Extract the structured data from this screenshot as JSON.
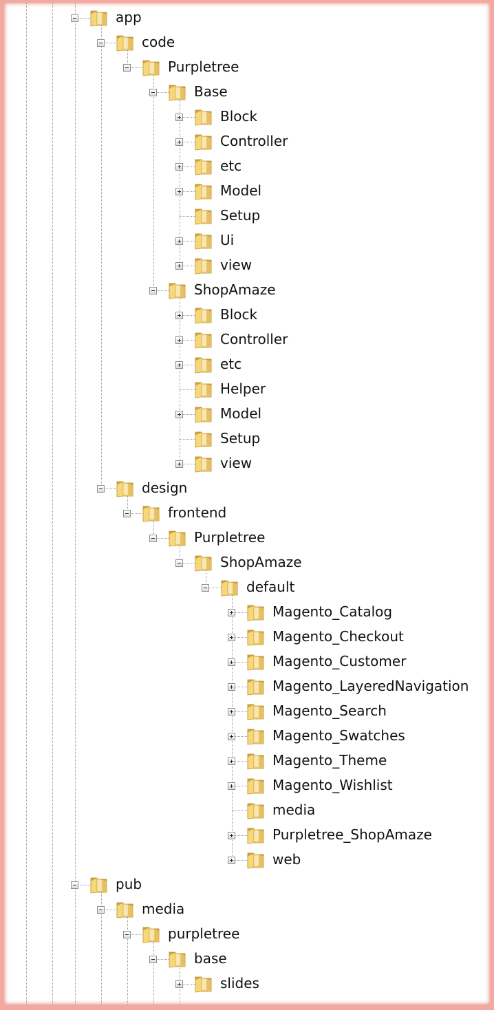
{
  "tree": {
    "expander_icons": {
      "expanded": "minus-box-icon",
      "collapsed": "plus-box-icon"
    },
    "folder_icon": "folder-icon",
    "colors": {
      "folder_back": "#d6a640",
      "folder_front": "#f6d77a",
      "connector": "#9a9a9a"
    },
    "nodes": [
      {
        "label": "app",
        "depth": 0,
        "state": "expanded"
      },
      {
        "label": "code",
        "depth": 1,
        "state": "expanded"
      },
      {
        "label": "Purpletree",
        "depth": 2,
        "state": "expanded"
      },
      {
        "label": "Base",
        "depth": 3,
        "state": "expanded"
      },
      {
        "label": "Block",
        "depth": 4,
        "state": "collapsed"
      },
      {
        "label": "Controller",
        "depth": 4,
        "state": "collapsed"
      },
      {
        "label": "etc",
        "depth": 4,
        "state": "collapsed"
      },
      {
        "label": "Model",
        "depth": 4,
        "state": "collapsed"
      },
      {
        "label": "Setup",
        "depth": 4,
        "state": "leaf"
      },
      {
        "label": "Ui",
        "depth": 4,
        "state": "collapsed"
      },
      {
        "label": "view",
        "depth": 4,
        "state": "collapsed"
      },
      {
        "label": "ShopAmaze",
        "depth": 3,
        "state": "expanded"
      },
      {
        "label": "Block",
        "depth": 4,
        "state": "collapsed"
      },
      {
        "label": "Controller",
        "depth": 4,
        "state": "collapsed"
      },
      {
        "label": "etc",
        "depth": 4,
        "state": "collapsed"
      },
      {
        "label": "Helper",
        "depth": 4,
        "state": "leaf"
      },
      {
        "label": "Model",
        "depth": 4,
        "state": "collapsed"
      },
      {
        "label": "Setup",
        "depth": 4,
        "state": "leaf"
      },
      {
        "label": "view",
        "depth": 4,
        "state": "collapsed"
      },
      {
        "label": "design",
        "depth": 1,
        "state": "expanded"
      },
      {
        "label": "frontend",
        "depth": 2,
        "state": "expanded"
      },
      {
        "label": "Purpletree",
        "depth": 3,
        "state": "expanded"
      },
      {
        "label": "ShopAmaze",
        "depth": 4,
        "state": "expanded"
      },
      {
        "label": "default",
        "depth": 5,
        "state": "expanded"
      },
      {
        "label": "Magento_Catalog",
        "depth": 6,
        "state": "collapsed"
      },
      {
        "label": "Magento_Checkout",
        "depth": 6,
        "state": "collapsed"
      },
      {
        "label": "Magento_Customer",
        "depth": 6,
        "state": "collapsed"
      },
      {
        "label": "Magento_LayeredNavigation",
        "depth": 6,
        "state": "collapsed"
      },
      {
        "label": "Magento_Search",
        "depth": 6,
        "state": "collapsed"
      },
      {
        "label": "Magento_Swatches",
        "depth": 6,
        "state": "collapsed"
      },
      {
        "label": "Magento_Theme",
        "depth": 6,
        "state": "collapsed"
      },
      {
        "label": "Magento_Wishlist",
        "depth": 6,
        "state": "collapsed"
      },
      {
        "label": "media",
        "depth": 6,
        "state": "leaf"
      },
      {
        "label": "Purpletree_ShopAmaze",
        "depth": 6,
        "state": "collapsed"
      },
      {
        "label": "web",
        "depth": 6,
        "state": "collapsed"
      },
      {
        "label": "pub",
        "depth": 0,
        "state": "expanded"
      },
      {
        "label": "media",
        "depth": 1,
        "state": "expanded"
      },
      {
        "label": "purpletree",
        "depth": 2,
        "state": "expanded"
      },
      {
        "label": "base",
        "depth": 3,
        "state": "expanded"
      },
      {
        "label": "slides",
        "depth": 4,
        "state": "collapsed"
      }
    ]
  }
}
